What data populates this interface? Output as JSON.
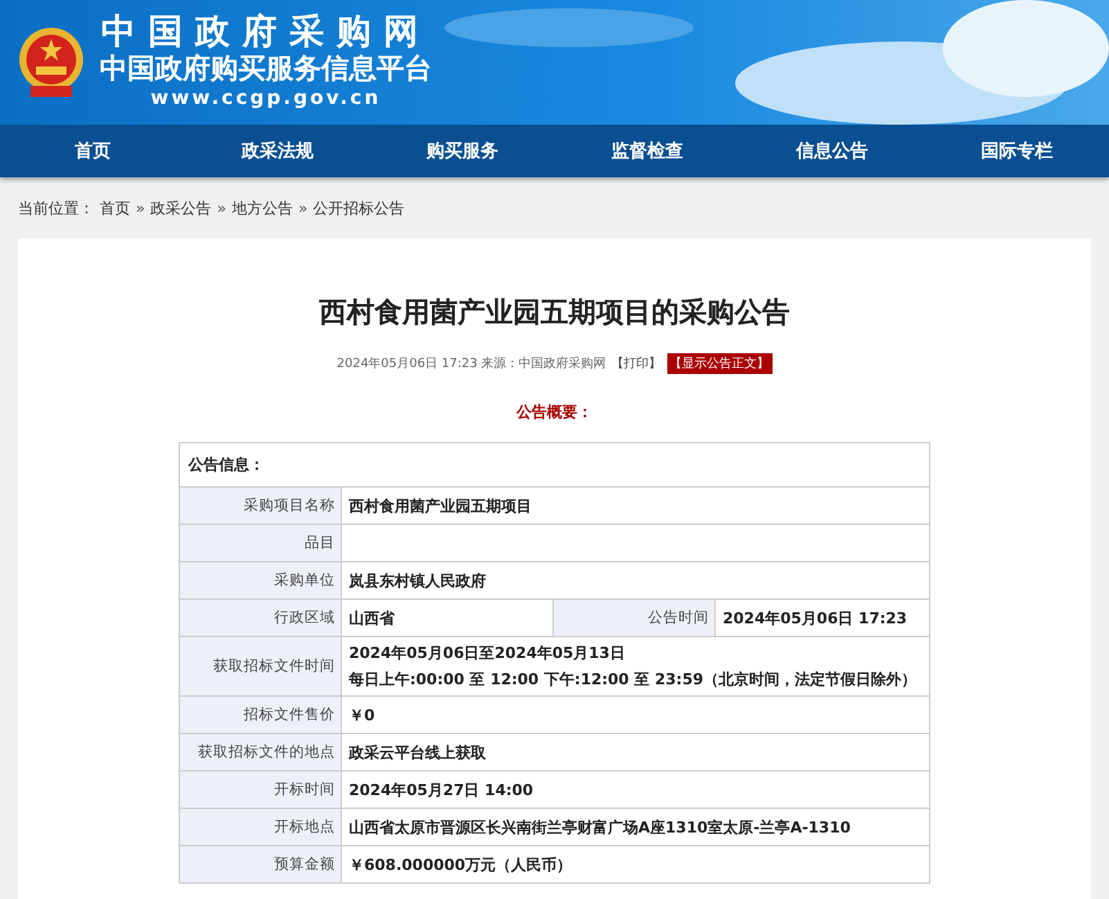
{
  "header": {
    "title": "中国政府采购网",
    "subtitle": "中国政府购买服务信息平台",
    "url": "www.ccgp.gov.cn"
  },
  "nav": [
    {
      "label": "首页"
    },
    {
      "label": "政采法规"
    },
    {
      "label": "购买服务"
    },
    {
      "label": "监督检查"
    },
    {
      "label": "信息公告"
    },
    {
      "label": "国际专栏"
    }
  ],
  "breadcrumb": {
    "label": "当前位置：",
    "items": [
      {
        "label": "首页"
      },
      {
        "label": "政采公告"
      },
      {
        "label": "地方公告"
      },
      {
        "label": "公开招标公告"
      }
    ],
    "separator": "»"
  },
  "article": {
    "title": "西村食用菌产业园五期项目的采购公告",
    "meta": "2024年05月06日 17:23 来源：中国政府采购网",
    "print_link": "【打印】",
    "show_text_button": "【显示公告正文】",
    "summary_heading": "公告概要："
  },
  "table": {
    "heading": "公告信息：",
    "rows": [
      {
        "kind": "single",
        "label": "采购项目名称",
        "value": [
          "西村食用菌产业园五期项目"
        ]
      },
      {
        "kind": "single",
        "label": "品目",
        "value": []
      },
      {
        "kind": "single",
        "label": "采购单位",
        "value": [
          "岚县东村镇人民政府"
        ]
      },
      {
        "kind": "split",
        "label": "行政区域",
        "value": [
          "山西省"
        ],
        "label2": "公告时间",
        "value2": "2024年05月06日 17:23"
      },
      {
        "kind": "single",
        "label": "获取招标文件时间",
        "value": [
          "2024年05月06日至2024年05月13日",
          "每日上午:00:00 至 12:00  下午:12:00 至 23:59（北京时间，法定节假日除外）"
        ]
      },
      {
        "kind": "single",
        "label": "招标文件售价",
        "value": [
          "￥0"
        ]
      },
      {
        "kind": "single",
        "label": "获取招标文件的地点",
        "value": [
          "政采云平台线上获取"
        ]
      },
      {
        "kind": "single",
        "label": "开标时间",
        "value": [
          "2024年05月27日 14:00"
        ]
      },
      {
        "kind": "single",
        "label": "开标地点",
        "value": [
          "山西省太原市晋源区长兴南街兰亭财富广场A座1310室太原-兰亭A-1310"
        ]
      },
      {
        "kind": "single",
        "label": "预算金额",
        "value": [
          "￥608.000000万元（人民币）"
        ]
      }
    ]
  }
}
